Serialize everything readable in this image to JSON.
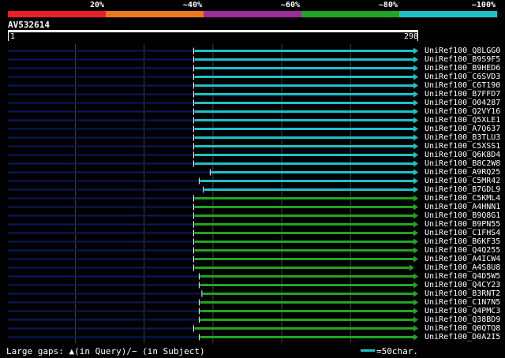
{
  "scale": {
    "segments": [
      {
        "label": "20%",
        "color": "#e8202a"
      },
      {
        "label": "~40%",
        "color": "#ec7a1c"
      },
      {
        "label": "~60%",
        "color": "#9b2e9b"
      },
      {
        "label": "~80%",
        "color": "#22a522"
      },
      {
        "label": "~100%",
        "color": "#20c0c8"
      }
    ]
  },
  "query": {
    "id": "AV532614",
    "start": "1",
    "end": "298",
    "length": 298
  },
  "colors": {
    "cyan": "#20c0c8",
    "green": "#22a522",
    "navy": "#0a1a5c",
    "grid": "#444444"
  },
  "hits": [
    {
      "label": "UniRef100_Q8LGG0",
      "start": 136,
      "color": "cyan",
      "arrow": 298
    },
    {
      "label": "UniRef100_B9S9F5",
      "start": 136,
      "color": "cyan",
      "arrow": 298
    },
    {
      "label": "UniRef100_B9HED6",
      "start": 136,
      "color": "cyan",
      "arrow": 298
    },
    {
      "label": "UniRef100_C6SVD3",
      "start": 136,
      "color": "cyan",
      "arrow": 298
    },
    {
      "label": "UniRef100_C6T190",
      "start": 136,
      "color": "cyan",
      "arrow": 298
    },
    {
      "label": "UniRef100_B7FFD7",
      "start": 136,
      "color": "cyan",
      "arrow": 298
    },
    {
      "label": "UniRef100_O04287",
      "start": 136,
      "color": "cyan",
      "arrow": 298
    },
    {
      "label": "UniRef100_Q2VY16",
      "start": 136,
      "color": "cyan",
      "arrow": 298
    },
    {
      "label": "UniRef100_Q5XLE1",
      "start": 136,
      "color": "cyan",
      "arrow": 298
    },
    {
      "label": "UniRef100_A7Q637",
      "start": 136,
      "color": "cyan",
      "arrow": 298
    },
    {
      "label": "UniRef100_B3TLU3",
      "start": 136,
      "color": "cyan",
      "arrow": 298
    },
    {
      "label": "UniRef100_C5XSS1",
      "start": 136,
      "color": "cyan",
      "arrow": 298
    },
    {
      "label": "UniRef100_Q6K8D4",
      "start": 136,
      "color": "cyan",
      "arrow": 298
    },
    {
      "label": "UniRef100_B8C2W8",
      "start": 136,
      "color": "cyan",
      "arrow": 298
    },
    {
      "label": "UniRef100_A9RQ25",
      "start": 148,
      "color": "cyan",
      "arrow": 298
    },
    {
      "label": "UniRef100_C5MR42",
      "start": 140,
      "color": "cyan",
      "arrow": 298
    },
    {
      "label": "UniRef100_B7GDL9",
      "start": 143,
      "color": "cyan",
      "arrow": 298
    },
    {
      "label": "UniRef100_C5KML4",
      "start": 136,
      "color": "green",
      "arrow": 298
    },
    {
      "label": "UniRef100_A4HNN1",
      "start": 136,
      "color": "green",
      "arrow": 298
    },
    {
      "label": "UniRef100_B9Q8G1",
      "start": 136,
      "color": "green",
      "arrow": 298
    },
    {
      "label": "UniRef100_B9PN55",
      "start": 136,
      "color": "green",
      "arrow": 298
    },
    {
      "label": "UniRef100_C1FHS4",
      "start": 136,
      "color": "green",
      "arrow": 298
    },
    {
      "label": "UniRef100_B6KF35",
      "start": 136,
      "color": "green",
      "arrow": 298
    },
    {
      "label": "UniRef100_Q4Q255",
      "start": 136,
      "color": "green",
      "arrow": 298
    },
    {
      "label": "UniRef100_A4ICW4",
      "start": 136,
      "color": "green",
      "arrow": 298
    },
    {
      "label": "UniRef100_A4S8U8",
      "start": 136,
      "color": "green",
      "arrow": 295
    },
    {
      "label": "UniRef100_Q4D5W5",
      "start": 140,
      "color": "green",
      "arrow": 298
    },
    {
      "label": "UniRef100_Q4CY23",
      "start": 140,
      "color": "green",
      "arrow": 298
    },
    {
      "label": "UniRef100_B3RNT2",
      "start": 142,
      "color": "green",
      "arrow": 298
    },
    {
      "label": "UniRef100_C1N7N5",
      "start": 140,
      "color": "green",
      "arrow": 298
    },
    {
      "label": "UniRef100_Q4PMC3",
      "start": 140,
      "color": "green",
      "arrow": 298
    },
    {
      "label": "UniRef100_Q38BD9",
      "start": 140,
      "color": "green",
      "arrow": 298
    },
    {
      "label": "UniRef100_Q0QTQ8",
      "start": 136,
      "color": "green",
      "arrow": 298
    },
    {
      "label": "UniRef100_D0A2I5",
      "start": 140,
      "color": "green",
      "arrow": 298
    }
  ],
  "footer": {
    "gaps_text": "Large gaps: ▲(in Query)/− (in Subject)",
    "legend_text": "=50char."
  }
}
